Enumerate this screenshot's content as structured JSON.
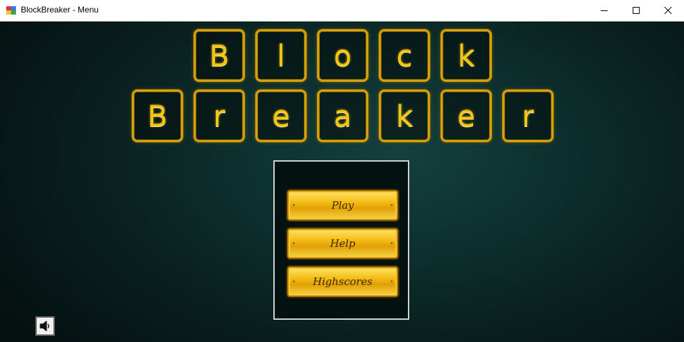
{
  "window": {
    "title": "BlockBreaker - Menu",
    "icon": "app-blocks-icon"
  },
  "title_rows": {
    "row1": [
      "B",
      "l",
      "o",
      "c",
      "k"
    ],
    "row2": [
      "B",
      "r",
      "e",
      "a",
      "k",
      "e",
      "r"
    ]
  },
  "menu": {
    "play_label": "Play",
    "help_label": "Help",
    "highscores_label": "Highscores"
  },
  "sound": {
    "icon": "speaker-icon"
  },
  "colors": {
    "gold": "#f2c313",
    "background": "#0d2f2d"
  }
}
